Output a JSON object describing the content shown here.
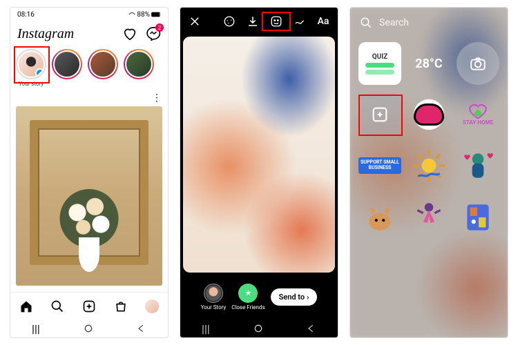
{
  "screen1": {
    "status": {
      "time": "08:16",
      "battery": "88%"
    },
    "brand": "Instagram",
    "dm_badge": "2",
    "stories": [
      {
        "label": "Your story",
        "me": true
      },
      {
        "label": "",
        "me": false
      },
      {
        "label": "",
        "me": false
      },
      {
        "label": "",
        "me": false
      }
    ]
  },
  "screen2": {
    "toolbar_text": "Aa",
    "chips": {
      "your_story": "Your Story",
      "close_friends": "Close Friends"
    },
    "send_to": "Send to",
    "send_arrow": "›"
  },
  "screen3": {
    "search_placeholder": "Search",
    "stickers": {
      "quiz_label": "QUIZ",
      "temperature": "28°C",
      "stay_home": "STAY HOME",
      "support": "SUPPORT SMALL BUSINESS"
    }
  }
}
